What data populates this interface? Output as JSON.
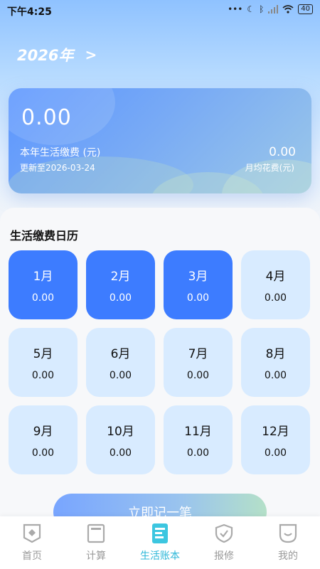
{
  "status_bar": {
    "time": "下午4:25",
    "battery": "40"
  },
  "header": {
    "year": "2026年",
    "chevron": ">"
  },
  "summary": {
    "total": "0.00",
    "total_label": "本年生活缴费 (元)",
    "updated": "更新至2026-03-24",
    "monthly_avg": "0.00",
    "monthly_avg_label": "月均花费(元)"
  },
  "calendar": {
    "title": "生活缴费日历",
    "months": [
      {
        "month": "1月",
        "amount": "0.00",
        "active": true
      },
      {
        "month": "2月",
        "amount": "0.00",
        "active": true
      },
      {
        "month": "3月",
        "amount": "0.00",
        "active": true
      },
      {
        "month": "4月",
        "amount": "0.00",
        "active": false
      },
      {
        "month": "5月",
        "amount": "0.00",
        "active": false
      },
      {
        "month": "6月",
        "amount": "0.00",
        "active": false
      },
      {
        "month": "7月",
        "amount": "0.00",
        "active": false
      },
      {
        "month": "8月",
        "amount": "0.00",
        "active": false
      },
      {
        "month": "9月",
        "amount": "0.00",
        "active": false
      },
      {
        "month": "10月",
        "amount": "0.00",
        "active": false
      },
      {
        "month": "11月",
        "amount": "0.00",
        "active": false
      },
      {
        "month": "12月",
        "amount": "0.00",
        "active": false
      }
    ]
  },
  "cta": {
    "label": "立即记一笔"
  },
  "bottom_nav": {
    "items": [
      {
        "label": "首页",
        "icon": "home-icon",
        "active": false
      },
      {
        "label": "计算",
        "icon": "calculator-icon",
        "active": false
      },
      {
        "label": "生活账本",
        "icon": "ledger-icon",
        "active": true
      },
      {
        "label": "报修",
        "icon": "repair-shield-icon",
        "active": false
      },
      {
        "label": "我的",
        "icon": "profile-icon",
        "active": false
      }
    ]
  },
  "colors": {
    "accent": "#3d7cff",
    "light_cell": "#d8ebff",
    "nav_active": "#2db7d8"
  }
}
